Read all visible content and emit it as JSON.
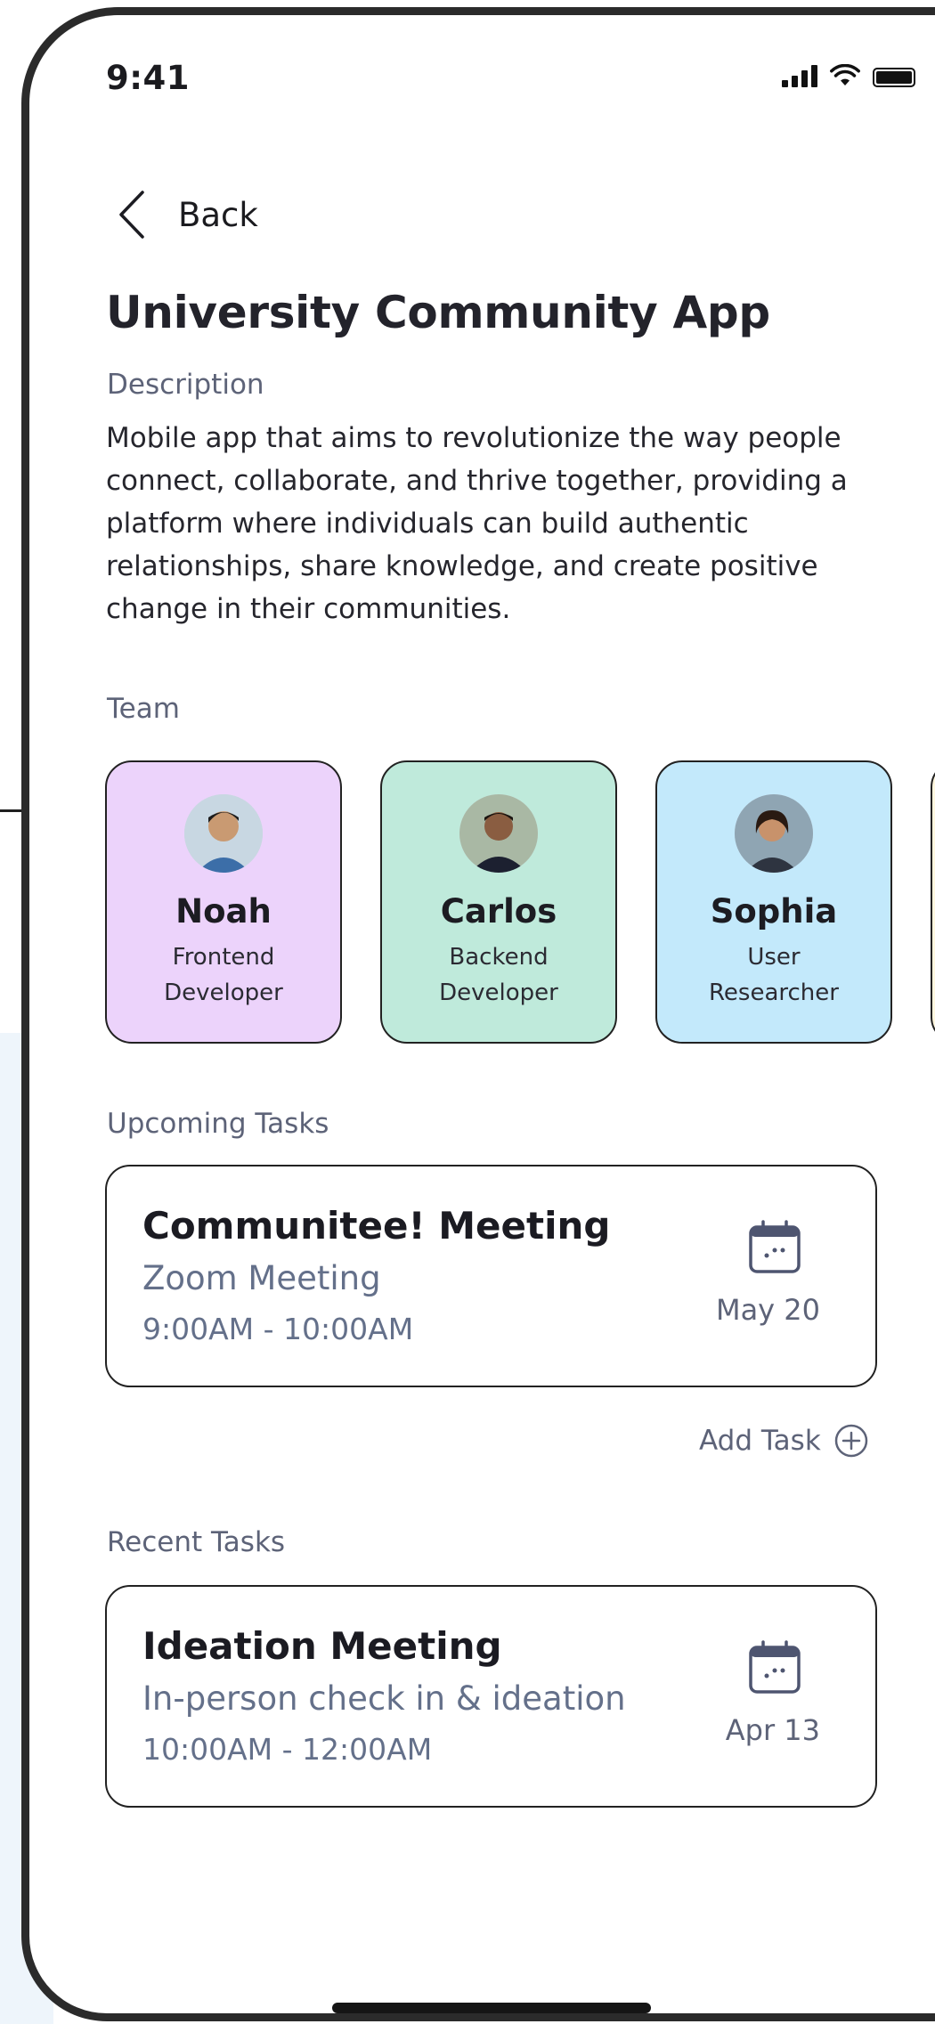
{
  "status_bar": {
    "time": "9:41",
    "signal_icon": "signal-bars-icon",
    "wifi_icon": "wifi-icon",
    "battery_icon": "battery-icon"
  },
  "nav": {
    "back_label": "Back",
    "back_icon": "chevron-left-icon"
  },
  "project": {
    "title": "University Community App",
    "description_label": "Description",
    "description": "Mobile app that aims to revolutionize the way people connect, collaborate, and thrive together, providing a platform where individuals can build authentic relationships, share knowledge, and create positive change in their communities."
  },
  "team": {
    "label": "Team",
    "members": [
      {
        "name": "Noah",
        "role": "Frontend Developer",
        "color": "#ecd3fb"
      },
      {
        "name": "Carlos",
        "role": "Backend Developer",
        "color": "#bfeadb"
      },
      {
        "name": "Sophia",
        "role": "User Researcher",
        "color": "#c3e9fb"
      }
    ]
  },
  "upcoming": {
    "label": "Upcoming Tasks",
    "task": {
      "title": "Communitee! Meeting",
      "subtitle": "Zoom Meeting",
      "time": "9:00AM - 10:00AM",
      "date": "May 20",
      "icon": "calendar-icon"
    },
    "add_task_label": "Add Task",
    "add_icon": "plus-circle-icon"
  },
  "recent": {
    "label": "Recent Tasks",
    "task": {
      "title": "Ideation Meeting",
      "subtitle": "In-person check in & ideation",
      "time": "10:00AM - 12:00AM",
      "date": "Apr 13",
      "icon": "calendar-icon"
    }
  }
}
